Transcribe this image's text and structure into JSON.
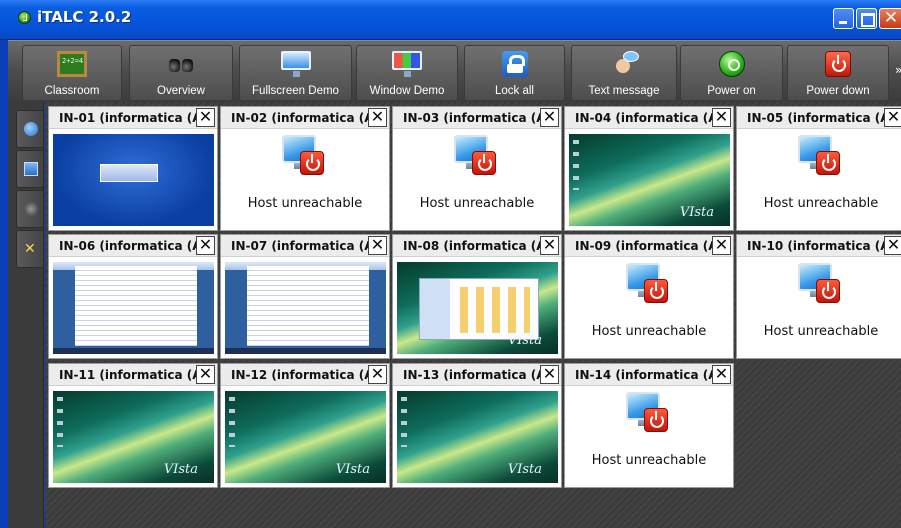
{
  "window": {
    "title": "iTALC 2.0.2"
  },
  "toolbar": {
    "buttons": [
      {
        "label": "Classroom",
        "icon": "chalkboard-icon"
      },
      {
        "label": "Overview",
        "icon": "binoculars-icon"
      },
      {
        "label": "Fullscreen Demo",
        "icon": "monitor-icon"
      },
      {
        "label": "Window Demo",
        "icon": "monitor-windows-icon"
      },
      {
        "label": "Lock all",
        "icon": "lock-icon"
      },
      {
        "label": "Text message",
        "icon": "message-icon"
      },
      {
        "label": "Power on",
        "icon": "power-on-icon"
      },
      {
        "label": "Power down",
        "icon": "power-down-icon"
      }
    ],
    "more": "»"
  },
  "sidebar": {
    "items": [
      {
        "icon": "network-icon"
      },
      {
        "icon": "snapshot-icon"
      },
      {
        "icon": "support-icon"
      },
      {
        "icon": "tools-icon"
      }
    ]
  },
  "clients": [
    {
      "name": "IN-01 (informatica (A",
      "status": "screen",
      "screen": "blue-login"
    },
    {
      "name": "IN-02 (informatica (A",
      "status": "Host unreachable"
    },
    {
      "name": "IN-03 (informatica (A",
      "status": "Host unreachable"
    },
    {
      "name": "IN-04 (informatica (A",
      "status": "screen",
      "screen": "vista-desktop"
    },
    {
      "name": "IN-05 (informatica (A",
      "status": "Host unreachable"
    },
    {
      "name": "IN-06 (informatica (A",
      "status": "screen",
      "screen": "word-document"
    },
    {
      "name": "IN-07 (informatica (A",
      "status": "screen",
      "screen": "word-document"
    },
    {
      "name": "IN-08 (informatica (A",
      "status": "screen",
      "screen": "explorer-window"
    },
    {
      "name": "IN-09 (informatica (A",
      "status": "Host unreachable"
    },
    {
      "name": "IN-10 (informatica (A",
      "status": "Host unreachable"
    },
    {
      "name": "IN-11 (informatica (A",
      "status": "screen",
      "screen": "vista-desktop"
    },
    {
      "name": "IN-12 (informatica (A",
      "status": "screen",
      "screen": "vista-desktop"
    },
    {
      "name": "IN-13 (informatica (A",
      "status": "screen",
      "screen": "vista-desktop"
    },
    {
      "name": "IN-14 (informatica (A",
      "status": "Host unreachable"
    }
  ],
  "close_glyph": "✕",
  "vista_logo": "VIsta"
}
